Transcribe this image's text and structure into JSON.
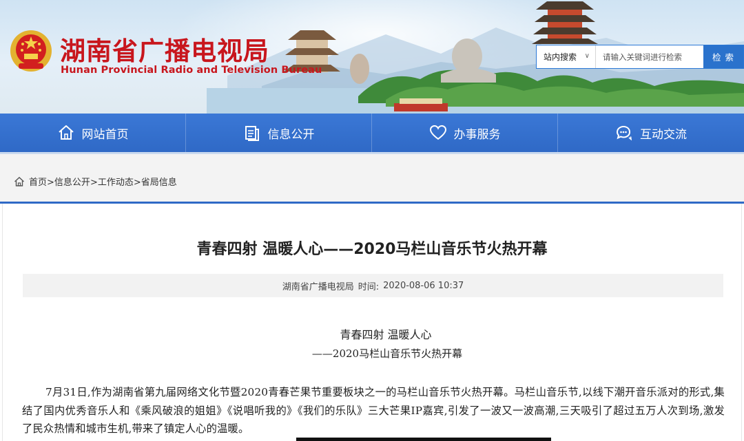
{
  "header": {
    "site_title": "湖南省广播电视局",
    "site_subtitle": "Hunan Provincial Radio and Television Bureau"
  },
  "search": {
    "scope_label": "站内搜索",
    "placeholder": "请输入关键词进行检索",
    "button_label": "检 索"
  },
  "nav": {
    "items": [
      {
        "label": "网站首页",
        "icon": "home-icon"
      },
      {
        "label": "信息公开",
        "icon": "document-icon"
      },
      {
        "label": "办事服务",
        "icon": "heart-icon"
      },
      {
        "label": "互动交流",
        "icon": "chat-icon"
      }
    ]
  },
  "breadcrumb": {
    "items": [
      "首页",
      "信息公开",
      "工作动态",
      "省局信息"
    ],
    "separator": ">"
  },
  "article": {
    "title": "青春四射  温暖人心——2020马栏山音乐节火热开幕",
    "source": "湖南省广播电视局",
    "time_label": "时间:",
    "time": "2020-08-06 10:37",
    "subtitle_line1": "青春四射  温暖人心",
    "subtitle_line2": "——2020马栏山音乐节火热开幕",
    "paragraph": "7月31日,作为湖南省第九届网络文化节暨2020青春芒果节重要板块之一的马栏山音乐节火热开幕。马栏山音乐节,以线下潮开音乐派对的形式,集结了国内优秀音乐人和《乘风破浪的姐姐》《说唱听我的》《我们的乐队》三大芒果IP嘉宾,引发了一波又一波高潮,三天吸引了超过五万人次到场,激发了民众热情和城市生机,带来了镇定人心的温暖。"
  },
  "colors": {
    "brand_red": "#c8161d",
    "nav_blue": "#2f69c6",
    "search_blue": "#2a72cc"
  }
}
